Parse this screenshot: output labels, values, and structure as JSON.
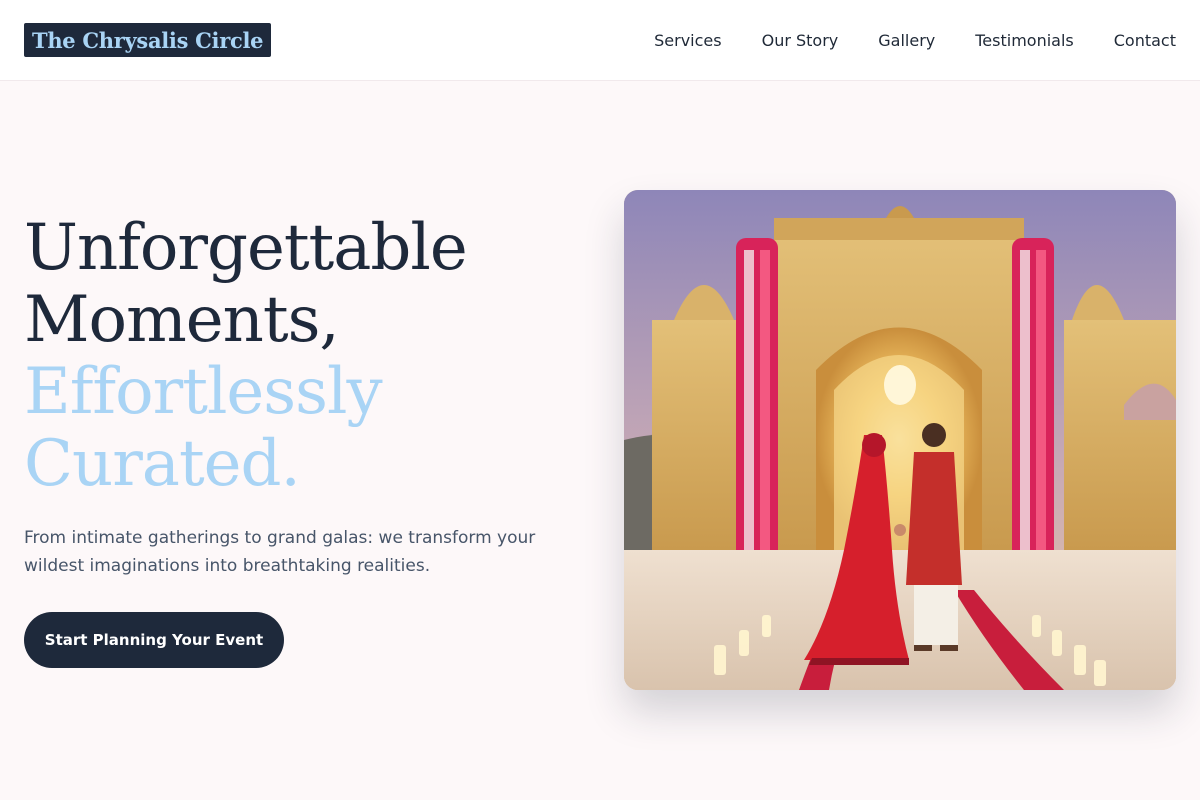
{
  "header": {
    "brand": "The Chrysalis Circle",
    "nav": [
      {
        "label": "Services"
      },
      {
        "label": "Our Story"
      },
      {
        "label": "Gallery"
      },
      {
        "label": "Testimonials"
      },
      {
        "label": "Contact"
      }
    ]
  },
  "hero": {
    "heading_line1": "Unforgettable",
    "heading_line2": "Moments,",
    "heading_accent_line1": "Effortlessly",
    "heading_accent_line2": "Curated.",
    "subtitle": "From intimate gatherings to grand galas: we transform your wildest imaginations into breathtaking realities.",
    "cta_label": "Start Planning Your Event"
  },
  "colors": {
    "primary": "#1e293b",
    "accent": "#a9d4f5",
    "background": "#fdf8f9"
  }
}
